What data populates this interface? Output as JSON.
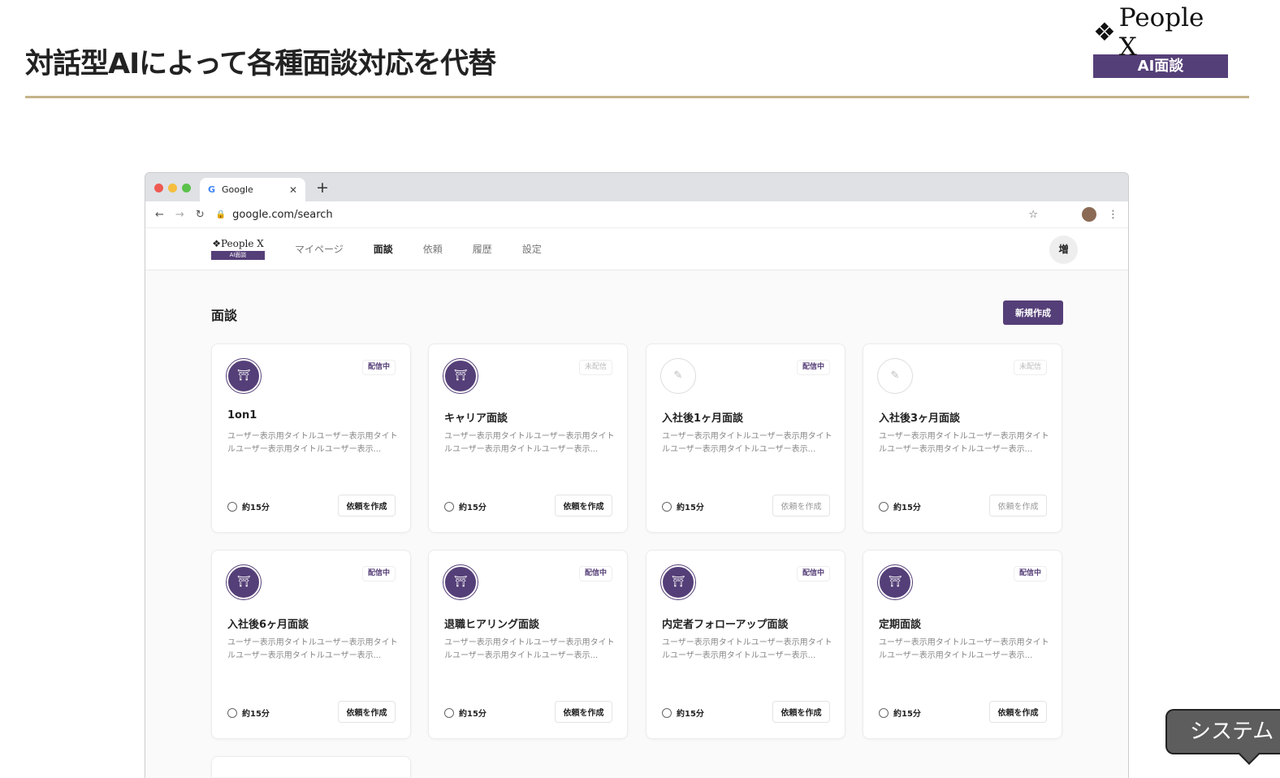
{
  "slide": {
    "title": "対話型AIによって各種面談対応を代替",
    "brand_name": "People X",
    "brand_badge": "AI面談"
  },
  "browser": {
    "tab_title": "Google",
    "url": "google.com/search"
  },
  "app": {
    "logo_name": "People X",
    "logo_badge": "AI面談",
    "nav": [
      "マイページ",
      "面談",
      "依頼",
      "履歴",
      "設定"
    ],
    "avatar": "増",
    "page_title": "面談",
    "new_button": "新規作成"
  },
  "cards": [
    {
      "title": "1on1",
      "status": "配信中",
      "desc": "ユーザー表示用タイトルユーザー表示用タイトルユーザー表示用タイトルユーザー表示...",
      "duration": "約15分",
      "button": "依頼を作成",
      "draft": false,
      "enabled": true
    },
    {
      "title": "キャリア面談",
      "status": "未配信",
      "desc": "ユーザー表示用タイトルユーザー表示用タイトルユーザー表示用タイトルユーザー表示...",
      "duration": "約15分",
      "button": "依頼を作成",
      "draft": false,
      "enabled": true
    },
    {
      "title": "入社後1ヶ月面談",
      "status": "配信中",
      "desc": "ユーザー表示用タイトルユーザー表示用タイトルユーザー表示用タイトルユーザー表示...",
      "duration": "約15分",
      "button": "依頼を作成",
      "draft": true,
      "enabled": false
    },
    {
      "title": "入社後3ヶ月面談",
      "status": "未配信",
      "desc": "ユーザー表示用タイトルユーザー表示用タイトルユーザー表示用タイトルユーザー表示...",
      "duration": "約15分",
      "button": "依頼を作成",
      "draft": true,
      "enabled": false
    },
    {
      "title": "入社後6ヶ月面談",
      "status": "配信中",
      "desc": "ユーザー表示用タイトルユーザー表示用タイトルユーザー表示用タイトルユーザー表示...",
      "duration": "約15分",
      "button": "依頼を作成",
      "draft": false,
      "enabled": true
    },
    {
      "title": "退職ヒアリング面談",
      "status": "配信中",
      "desc": "ユーザー表示用タイトルユーザー表示用タイトルユーザー表示用タイトルユーザー表示...",
      "duration": "約15分",
      "button": "依頼を作成",
      "draft": false,
      "enabled": true
    },
    {
      "title": "内定者フォローアップ面談",
      "status": "配信中",
      "desc": "ユーザー表示用タイトルユーザー表示用タイトルユーザー表示用タイトルユーザー表示...",
      "duration": "約15分",
      "button": "依頼を作成",
      "draft": false,
      "enabled": true
    },
    {
      "title": "定期面談",
      "status": "配信中",
      "desc": "ユーザー表示用タイトルユーザー表示用タイトルユーザー表示用タイトルユーザー表示...",
      "duration": "約15分",
      "button": "依頼を作成",
      "draft": false,
      "enabled": true
    }
  ],
  "tooltip": "システム"
}
